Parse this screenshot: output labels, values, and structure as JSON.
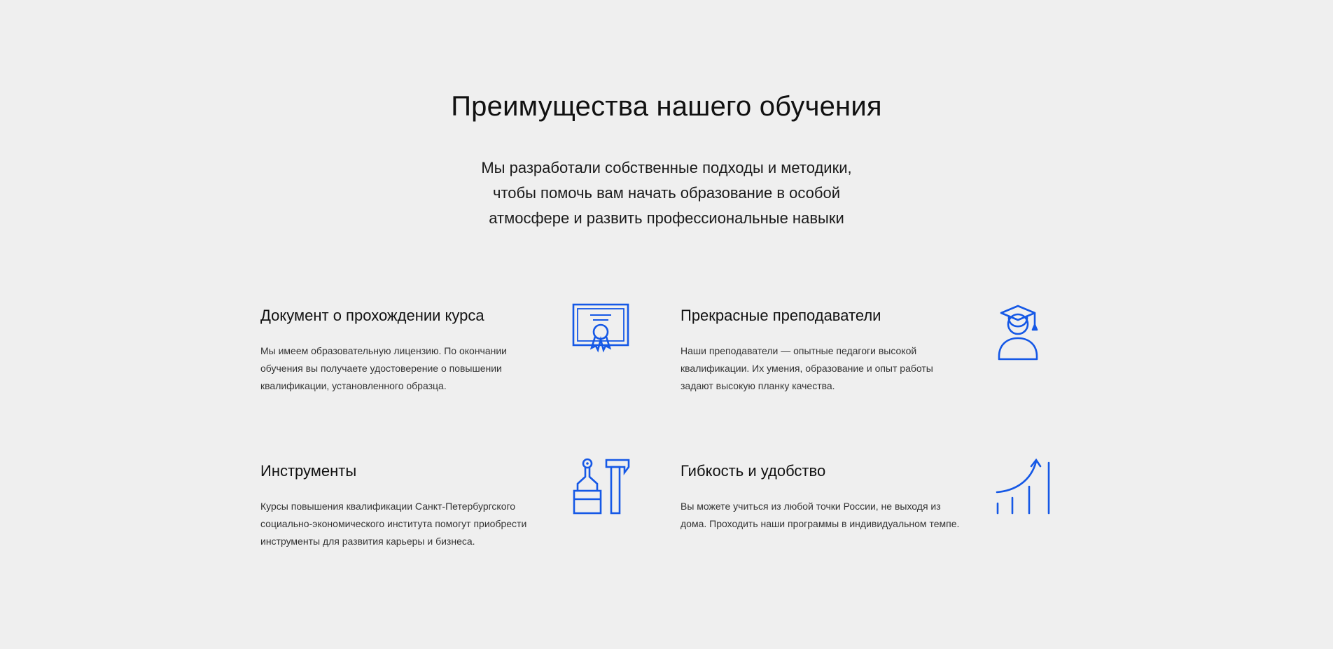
{
  "section": {
    "title": "Преимущества нашего обучения",
    "subtitle_lines": [
      "Мы разработали собственные подходы и методики,",
      "чтобы помочь вам начать образование в особой",
      "атмосфере и развить профессиональные навыки"
    ]
  },
  "colors": {
    "background": "#efefef",
    "accent": "#1558e6",
    "text": "#111111"
  },
  "features": [
    {
      "title": "Документ о прохождении курса",
      "text": "Мы имеем образовательную лицензию. По окончании обучения вы получаете удостоверение о повышении квалификации, установленного образца.",
      "icon": "certificate-icon"
    },
    {
      "title": "Прекрасные преподаватели",
      "text": "Наши преподаватели — опытные педагоги высокой квалификации. Их умения, образование и опыт работы задают высокую планку качества.",
      "icon": "graduate-teacher-icon"
    },
    {
      "title": "Инструменты",
      "text": "Курсы повышения квалификации Санкт-Петербургского социально-экономического института помогут приобрести инструменты для развития карьеры и бизнеса.",
      "icon": "tools-brush-hammer-icon"
    },
    {
      "title": "Гибкость и удобство",
      "text": "Вы можете учиться из любой точки России, не выходя из дома. Проходить наши программы в индивидуальном темпе.",
      "icon": "growth-chart-icon"
    }
  ]
}
